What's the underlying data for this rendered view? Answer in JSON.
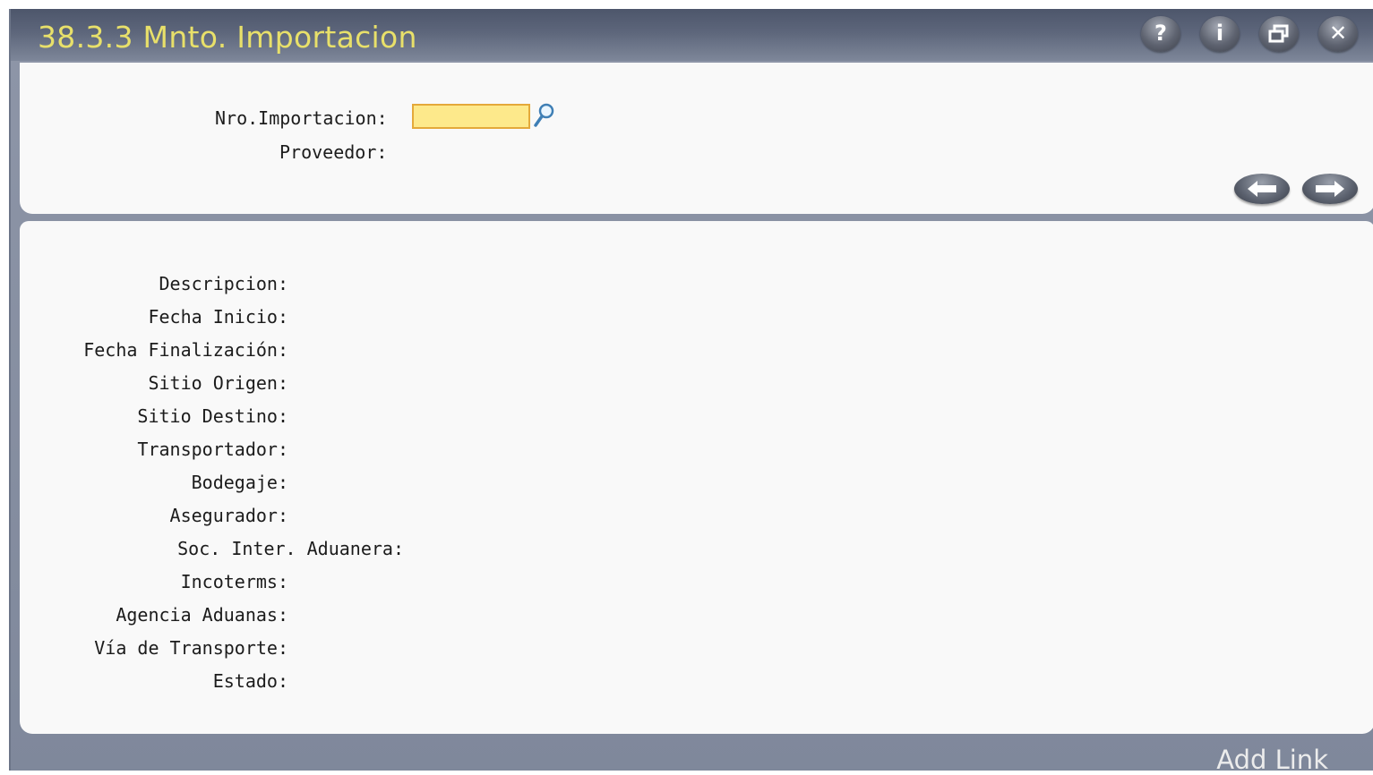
{
  "window": {
    "title": "38.3.3 Mnto. Importacion",
    "controls": [
      "help-icon",
      "info-icon",
      "restore-icon",
      "close-icon"
    ]
  },
  "search": {
    "nro_label": "Nro.Importacion:",
    "nro_value": "",
    "proveedor_label": "Proveedor:",
    "proveedor_value": ""
  },
  "detail": {
    "fields": [
      "Descripcion:",
      "Fecha Inicio:",
      "Fecha Finalización:",
      "Sitio Origen:",
      "Sitio Destino:",
      "Transportador:",
      "Bodegaje:",
      "Asegurador:",
      "Soc. Inter. Aduanera:",
      "Incoterms:",
      "Agencia Aduanas:",
      "Vía de Transporte:",
      "Estado:"
    ]
  },
  "footer": {
    "link_label": "Add Link"
  },
  "colors": {
    "title_text": "#e8e06a",
    "input_fill": "#fde98b",
    "input_border": "#e4a93a",
    "frame": "#8e96a8",
    "panel": "#f9f9f9"
  }
}
